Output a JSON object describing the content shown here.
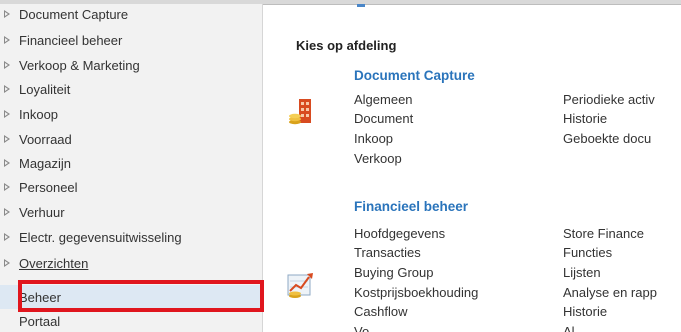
{
  "sidebar": {
    "items": [
      {
        "label": "Document Capture"
      },
      {
        "label": "Financieel beheer"
      },
      {
        "label": "Verkoop & Marketing"
      },
      {
        "label": "Loyaliteit"
      },
      {
        "label": "Inkoop"
      },
      {
        "label": "Voorraad"
      },
      {
        "label": "Magazijn"
      },
      {
        "label": "Personeel"
      },
      {
        "label": "Verhuur"
      },
      {
        "label": "Electr. gegevensuitwisseling"
      },
      {
        "label": "Overzichten"
      },
      {
        "label": "Beheer"
      },
      {
        "label": "Portaal"
      }
    ]
  },
  "main": {
    "heading": "Kies op afdeling",
    "groups": [
      {
        "title": "Document Capture",
        "icon": "building-icon",
        "col1": [
          "Algemeen",
          "Document",
          "Inkoop",
          "Verkoop"
        ],
        "col2": [
          "Periodieke activ",
          "Historie",
          "Geboekte docu"
        ]
      },
      {
        "title": "Financieel beheer",
        "icon": "finance-chart-icon",
        "col1": [
          "Hoofdgegevens",
          "Transacties",
          "Buying Group",
          "Kostprijsboekhouding",
          "Cashflow",
          "Vo"
        ],
        "col2": [
          "Store Finance",
          "Functies",
          "Lijsten",
          "Analyse en rapp",
          "Historie",
          "Al"
        ]
      }
    ]
  },
  "colors": {
    "accent": "#2a74bb",
    "sidebar_bg": "#f2f2f2",
    "selected_bg": "#dde8f3",
    "highlight": "#e0161e"
  }
}
